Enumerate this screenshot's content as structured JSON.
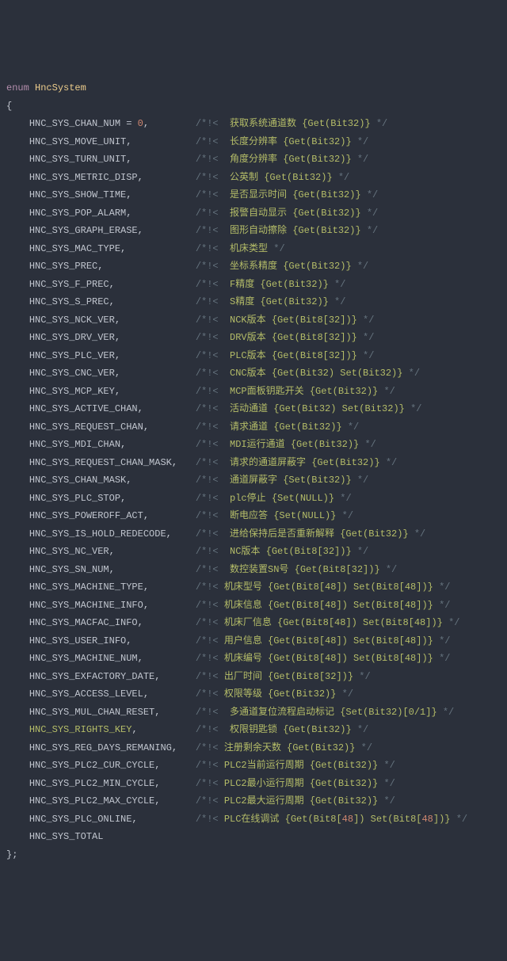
{
  "header": {
    "keyword": "enum",
    "typename": "HncSystem",
    "open": "{",
    "close": "};"
  },
  "rows": [
    {
      "name": "HNC_SYS_CHAN_NUM",
      "suffix": " = ",
      "num": "0",
      "comma": ",",
      "cmt_pre": "/*!<  ",
      "cmt_hi": "获取系统通道数 {Get(Bit32)}",
      "cmt_post": " */"
    },
    {
      "name": "HNC_SYS_MOVE_UNIT",
      "comma": ",",
      "cmt_pre": "/*!<  ",
      "cmt_hi": "长度分辨率 {Get(Bit32)}",
      "cmt_post": " */"
    },
    {
      "name": "HNC_SYS_TURN_UNIT",
      "comma": ",",
      "cmt_pre": "/*!<  ",
      "cmt_hi": "角度分辨率 {Get(Bit32)}",
      "cmt_post": " */"
    },
    {
      "name": "HNC_SYS_METRIC_DISP",
      "comma": ",",
      "cmt_pre": "/*!<  ",
      "cmt_hi": "公英制 {Get(Bit32)}",
      "cmt_post": " */"
    },
    {
      "name": "HNC_SYS_SHOW_TIME",
      "comma": ",",
      "cmt_pre": "/*!<  ",
      "cmt_hi": "是否显示时间 {Get(Bit32)}",
      "cmt_post": " */"
    },
    {
      "name": "HNC_SYS_POP_ALARM",
      "comma": ",",
      "cmt_pre": "/*!<  ",
      "cmt_hi": "报警自动显示 {Get(Bit32)}",
      "cmt_post": " */"
    },
    {
      "name": "HNC_SYS_GRAPH_ERASE",
      "comma": ",",
      "cmt_pre": "/*!<  ",
      "cmt_hi": "图形自动擦除 {Get(Bit32)}",
      "cmt_post": " */"
    },
    {
      "name": "HNC_SYS_MAC_TYPE",
      "comma": ",",
      "cmt_pre": "/*!<  ",
      "cmt_hi": "机床类型",
      "cmt_post": " */"
    },
    {
      "name": "HNC_SYS_PREC",
      "comma": ",",
      "cmt_pre": "/*!<  ",
      "cmt_hi": "坐标系精度 {Get(Bit32)}",
      "cmt_post": " */"
    },
    {
      "name": "HNC_SYS_F_PREC",
      "comma": ",",
      "cmt_pre": "/*!<  ",
      "cmt_hi": "F精度 {Get(Bit32)}",
      "cmt_post": " */"
    },
    {
      "name": "HNC_SYS_S_PREC",
      "comma": ",",
      "cmt_pre": "/*!<  ",
      "cmt_hi": "S精度 {Get(Bit32)}",
      "cmt_post": " */"
    },
    {
      "name": "HNC_SYS_NCK_VER",
      "comma": ",",
      "cmt_pre": "/*!<  ",
      "cmt_hi": "NCK版本 {Get(Bit8[32])}",
      "cmt_post": " */"
    },
    {
      "name": "HNC_SYS_DRV_VER",
      "comma": ",",
      "cmt_pre": "/*!<  ",
      "cmt_hi": "DRV版本 {Get(Bit8[32])}",
      "cmt_post": " */"
    },
    {
      "name": "HNC_SYS_PLC_VER",
      "comma": ",",
      "cmt_pre": "/*!<  ",
      "cmt_hi": "PLC版本 {Get(Bit8[32])}",
      "cmt_post": " */"
    },
    {
      "name": "HNC_SYS_CNC_VER",
      "comma": ",",
      "cmt_pre": "/*!<  ",
      "cmt_hi": "CNC版本 {Get(Bit32) Set(Bit32)}",
      "cmt_post": " */"
    },
    {
      "name": "HNC_SYS_MCP_KEY",
      "comma": ",",
      "cmt_pre": "/*!<  ",
      "cmt_hi": "MCP面板钥匙开关 {Get(Bit32)}",
      "cmt_post": " */"
    },
    {
      "name": "HNC_SYS_ACTIVE_CHAN",
      "comma": ",",
      "cmt_pre": "/*!<  ",
      "cmt_hi": "活动通道 {Get(Bit32) Set(Bit32)}",
      "cmt_post": " */"
    },
    {
      "name": "HNC_SYS_REQUEST_CHAN",
      "comma": ",",
      "cmt_pre": "/*!<  ",
      "cmt_hi": "请求通道 {Get(Bit32)}",
      "cmt_post": " */"
    },
    {
      "name": "HNC_SYS_MDI_CHAN",
      "comma": ",",
      "cmt_pre": "/*!<  ",
      "cmt_hi": "MDI运行通道 {Get(Bit32)}",
      "cmt_post": " */"
    },
    {
      "name": "HNC_SYS_REQUEST_CHAN_MASK",
      "comma": ",",
      "cmt_pre": "/*!<  ",
      "cmt_hi": "请求的通道屏蔽字 {Get(Bit32)}",
      "cmt_post": " */"
    },
    {
      "name": "HNC_SYS_CHAN_MASK",
      "comma": ",",
      "cmt_pre": "/*!<  ",
      "cmt_hi": "通道屏蔽字 {Set(Bit32)}",
      "cmt_post": " */"
    },
    {
      "name": "HNC_SYS_PLC_STOP",
      "comma": ",",
      "cmt_pre": "/*!<  ",
      "cmt_hi": "plc停止 {Set(NULL)}",
      "cmt_post": " */"
    },
    {
      "name": "HNC_SYS_POWEROFF_ACT",
      "comma": ",",
      "cmt_pre": "/*!<  ",
      "cmt_hi": "断电应答 {Set(NULL)}",
      "cmt_post": " */"
    },
    {
      "name": "HNC_SYS_IS_HOLD_REDECODE",
      "comma": ",",
      "cmt_pre": "/*!<  ",
      "cmt_hi": "进给保持后是否重新解释 {Get(Bit32)}",
      "cmt_post": " */"
    },
    {
      "name": "HNC_SYS_NC_VER",
      "comma": ",",
      "cmt_pre": "/*!<  ",
      "cmt_hi": "NC版本 {Get(Bit8[32])}",
      "cmt_post": " */"
    },
    {
      "name": "HNC_SYS_SN_NUM",
      "comma": ",",
      "cmt_pre": "/*!<  ",
      "cmt_hi": "数控装置SN号 {Get(Bit8[32])}",
      "cmt_post": " */"
    },
    {
      "name": "HNC_SYS_MACHINE_TYPE",
      "comma": ",",
      "cmt_pre": "/*!< ",
      "cmt_hi": "机床型号 {Get(Bit8[48]) Set(Bit8[48])}",
      "cmt_post": " */"
    },
    {
      "name": "HNC_SYS_MACHINE_INFO",
      "comma": ",",
      "cmt_pre": "/*!< ",
      "cmt_hi": "机床信息 {Get(Bit8[48]) Set(Bit8[48])}",
      "cmt_post": " */"
    },
    {
      "name": "HNC_SYS_MACFAC_INFO",
      "comma": ",",
      "cmt_pre": "/*!< ",
      "cmt_hi": "机床厂信息 {Get(Bit8[48]) Set(Bit8[48])}",
      "cmt_post": " */"
    },
    {
      "name": "HNC_SYS_USER_INFO",
      "comma": ",",
      "cmt_pre": "/*!< ",
      "cmt_hi": "用户信息 {Get(Bit8[48]) Set(Bit8[48])}",
      "cmt_post": " */"
    },
    {
      "name": "HNC_SYS_MACHINE_NUM",
      "comma": ",",
      "cmt_pre": "/*!< ",
      "cmt_hi": "机床编号 {Get(Bit8[48]) Set(Bit8[48])}",
      "cmt_post": " */"
    },
    {
      "name": "HNC_SYS_EXFACTORY_DATE",
      "comma": ",",
      "cmt_pre": "/*!< ",
      "cmt_hi": "出厂时间 {Get(Bit8[32])}",
      "cmt_post": " */"
    },
    {
      "name": "HNC_SYS_ACCESS_LEVEL",
      "comma": ",",
      "cmt_pre": "/*!< ",
      "cmt_hi": "权限等级 {Get(Bit32)}",
      "cmt_post": " */"
    },
    {
      "name": "HNC_SYS_MUL_CHAN_RESET",
      "comma": ",",
      "cmt_pre": "/*!<  ",
      "cmt_hi": "多通道复位流程启动标记 {Set(Bit32)[0/1]}",
      "cmt_post": " */"
    },
    {
      "name": "HNC_SYS_RIGHTS_KEY",
      "hi_name": true,
      "comma": ",",
      "cmt_pre": "/*!<  ",
      "cmt_hi": "权限钥匙锁 {Get(Bit32)}",
      "cmt_post": " */"
    },
    {
      "name": "HNC_SYS_REG_DAYS_REMANING",
      "comma": ",",
      "cmt_pre": "/*!< ",
      "cmt_hi": "注册剩余天数 {Get(Bit32)}",
      "cmt_post": " */"
    },
    {
      "name": "HNC_SYS_PLC2_CUR_CYCLE",
      "comma": ",",
      "cmt_pre": "/*!< ",
      "cmt_hi": "PLC2当前运行周期 {Get(Bit32)}",
      "cmt_post": " */"
    },
    {
      "name": "HNC_SYS_PLC2_MIN_CYCLE",
      "comma": ",",
      "cmt_pre": "/*!< ",
      "cmt_hi": "PLC2最小运行周期 {Get(Bit32)}",
      "cmt_post": " */"
    },
    {
      "name": "HNC_SYS_PLC2_MAX_CYCLE",
      "comma": ",",
      "cmt_pre": "/*!< ",
      "cmt_hi": "PLC2最大运行周期 {Get(Bit32)}",
      "cmt_post": " */"
    },
    {
      "name": "HNC_SYS_PLC_ONLINE",
      "comma": ",",
      "cmt_pre": "/*!< ",
      "cmt_hi_split": [
        "PLC在线调试 {Get(Bit8[",
        "48",
        "]) Set(Bit8[",
        "48",
        "])}"
      ],
      "cmt_post": " */"
    },
    {
      "name": "HNC_SYS_TOTAL",
      "comma": ""
    }
  ]
}
